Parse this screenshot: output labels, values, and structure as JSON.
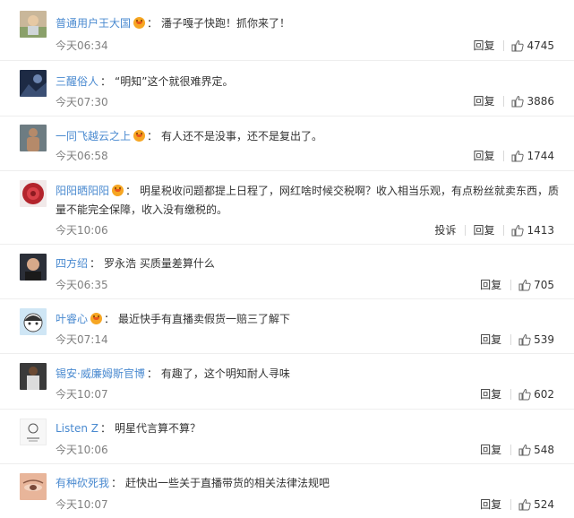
{
  "comments": [
    {
      "username": "普通用户王大国",
      "colon": "：",
      "text": "潘子嘎子快跑！抓你来了！",
      "time": "今天06:34",
      "reply": "回复",
      "likes": "4745"
    },
    {
      "username": "三醒俗人",
      "colon": "：",
      "text": "“明知”这个就很难界定。",
      "time": "今天07:30",
      "reply": "回复",
      "likes": "3886"
    },
    {
      "username": "一同飞越云之上",
      "colon": "：",
      "text": "有人还不是没事，还不是复出了。",
      "time": "今天06:58",
      "reply": "回复",
      "likes": "1744"
    },
    {
      "username": "阳阳晒阳阳",
      "colon": "：",
      "text": "明星税收问题都提上日程了，网红啥时候交税啊？收入相当乐观，有点粉丝就卖东西，质量不能完全保障，收入没有缴税的。",
      "time": "今天10:06",
      "report": "投诉",
      "reply": "回复",
      "likes": "1413"
    },
    {
      "username": "四方绍",
      "colon": "：",
      "text": "罗永浩 买质量差算什么",
      "time": "今天06:35",
      "reply": "回复",
      "likes": "705"
    },
    {
      "username": "叶睿心",
      "colon": "：",
      "text": "最近快手有直播卖假货一赔三了解下",
      "time": "今天07:14",
      "reply": "回复",
      "likes": "539"
    },
    {
      "username": "锡安·威廉姆斯官博",
      "colon": "：",
      "text": "有趣了，这个明知耐人寻味",
      "time": "今天10:07",
      "reply": "回复",
      "likes": "602"
    },
    {
      "username": "Listen Z",
      "colon": "：",
      "text": "明星代言算不算？",
      "time": "今天10:06",
      "reply": "回复",
      "likes": "548"
    },
    {
      "username": "有种砍死我",
      "colon": "：",
      "text": "赶快出一些关于直播带货的相关法律法规吧",
      "time": "今天10:07",
      "reply": "回复",
      "likes": "524"
    }
  ],
  "avatars": [
    "person-photo",
    "dark-scene",
    "shirtless-man",
    "red-flower",
    "man-portrait",
    "cartoon-character",
    "basketball-player",
    "sketch-drawing",
    "face-closeup"
  ],
  "colors": {
    "username": "#4a8ad0",
    "text": "#333333",
    "time": "#808080",
    "divider": "#eeeeee",
    "vip_badge": "#f6a623"
  }
}
